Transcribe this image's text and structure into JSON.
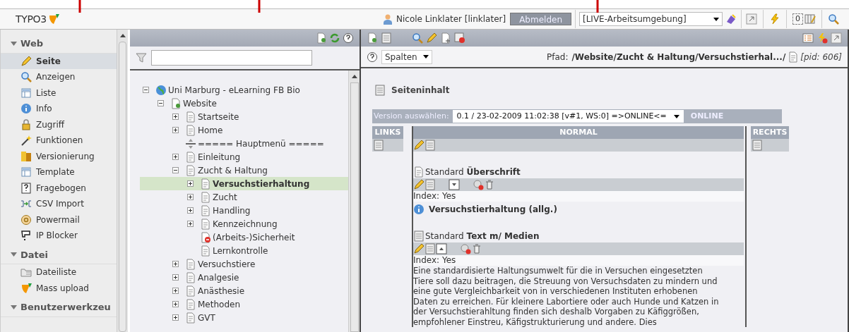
{
  "top_bar": {
    "logo": "TYPO3",
    "user": "Nicole Linklater [linklater]",
    "logout": "Abmelden",
    "workspace": "[LIVE-Arbeitsumgebung]",
    "counter": "0"
  },
  "module_menu": [
    {
      "title": "Web",
      "expanded": true,
      "items": [
        {
          "label": "Seite",
          "selected": true
        },
        {
          "label": "Anzeigen",
          "selected": false
        },
        {
          "label": "Liste",
          "selected": false
        },
        {
          "label": "Info",
          "selected": false
        },
        {
          "label": "Zugriff",
          "selected": false
        },
        {
          "label": "Funktionen",
          "selected": false
        },
        {
          "label": "Versionierung",
          "selected": false
        },
        {
          "label": "Template",
          "selected": false
        },
        {
          "label": "Fragebogen",
          "selected": false
        },
        {
          "label": "CSV Import",
          "selected": false
        },
        {
          "label": "Powermail",
          "selected": false
        },
        {
          "label": "IP Blocker",
          "selected": false
        }
      ]
    },
    {
      "title": "Datei",
      "expanded": true,
      "items": [
        {
          "label": "Dateiliste",
          "selected": false
        },
        {
          "label": "Mass upload",
          "selected": false
        }
      ]
    },
    {
      "title": "Benutzerwerkzeu",
      "expanded": true
    }
  ],
  "page_tree": {
    "nodes": [
      {
        "label": "Uni Marburg - eLearning FB Bio",
        "kind": "site",
        "expandable": true,
        "expanded": true,
        "selected": false,
        "children": [
          {
            "label": "Website",
            "kind": "root",
            "expandable": true,
            "expanded": true,
            "selected": false,
            "children": [
              {
                "label": "Startseite",
                "kind": "plain",
                "expandable": true,
                "expanded": false,
                "selected": false
              },
              {
                "label": "Home",
                "kind": "page",
                "expandable": true,
                "expanded": false,
                "selected": false
              },
              {
                "label": "===== Hauptmenü =====",
                "kind": "separator",
                "expandable": false,
                "expanded": false,
                "selected": false
              },
              {
                "label": "Einleitung",
                "kind": "page",
                "expandable": true,
                "expanded": false,
                "selected": false
              },
              {
                "label": "Zucht & Haltung",
                "kind": "page",
                "expandable": true,
                "expanded": true,
                "selected": false,
                "children": [
                  {
                    "label": "Versuchstierhaltung",
                    "kind": "page",
                    "expandable": true,
                    "expanded": false,
                    "selected": true
                  },
                  {
                    "label": "Zucht",
                    "kind": "page",
                    "expandable": true,
                    "expanded": false,
                    "selected": false
                  },
                  {
                    "label": "Handling",
                    "kind": "page",
                    "expandable": true,
                    "expanded": false,
                    "selected": false
                  },
                  {
                    "label": "Kennzeichnung",
                    "kind": "page",
                    "expandable": true,
                    "expanded": false,
                    "selected": false
                  },
                  {
                    "label": "(Arbeits-)Sicherheit",
                    "kind": "restricted",
                    "expandable": false,
                    "expanded": false,
                    "selected": false
                  },
                  {
                    "label": "Lernkontrolle",
                    "kind": "page",
                    "expandable": false,
                    "expanded": false,
                    "selected": false
                  }
                ]
              },
              {
                "label": "Versuchstiere",
                "kind": "page",
                "expandable": true,
                "expanded": false,
                "selected": false
              },
              {
                "label": "Analgesie",
                "kind": "page",
                "expandable": true,
                "expanded": false,
                "selected": false
              },
              {
                "label": "Anästhesie",
                "kind": "page",
                "expandable": true,
                "expanded": false,
                "selected": false
              },
              {
                "label": "Methoden",
                "kind": "page",
                "expandable": true,
                "expanded": false,
                "selected": false
              },
              {
                "label": "GVT",
                "kind": "page",
                "expandable": true,
                "expanded": false,
                "selected": false
              }
            ]
          }
        ]
      }
    ]
  },
  "content": {
    "view_select": "Spalten",
    "path_label": "Pfad:",
    "path": "/Website/Zucht & Haltung/Versuchstierhal.../",
    "pid": "[pid: 606]",
    "section_title": "Seiteninhalt",
    "version_label": "Version auswählen:",
    "version_value": "0.1 / 23-02-2009 11:02:38 [v#1, WS:0] =>ONLINE<=",
    "version_state": "ONLINE",
    "columns": [
      {
        "title": "LINKS"
      },
      {
        "title": "NORMAL"
      },
      {
        "title": "RECHTS"
      }
    ],
    "elements": [
      {
        "kind": "header",
        "type": "Standard",
        "title": "Überschrift",
        "index": "Index: Yes",
        "heading": "Versuchstierhaltung (allg.)"
      },
      {
        "kind": "textmedia",
        "type": "Standard",
        "title": "Text m/ Medien",
        "index": "Index: Yes",
        "body": "Eine standardisierte Haltungsumwelt für die in Versuchen eingesetzten Tiere soll dazu beitragen, die Streuung von Versuchsdaten zu mindern und eine gute Vergleichbarkeit von in verschiedenen Instituten erhobenen Daten zu erreichen. Für kleinere Labortiere oder auch Hunde und Katzen in der Versuchstierahltung finden sich deshalb Vorgaben zu Käfiggrößen, empfohlener Einstreu, Käfigstrukturierung und andere. Dies"
      }
    ]
  }
}
